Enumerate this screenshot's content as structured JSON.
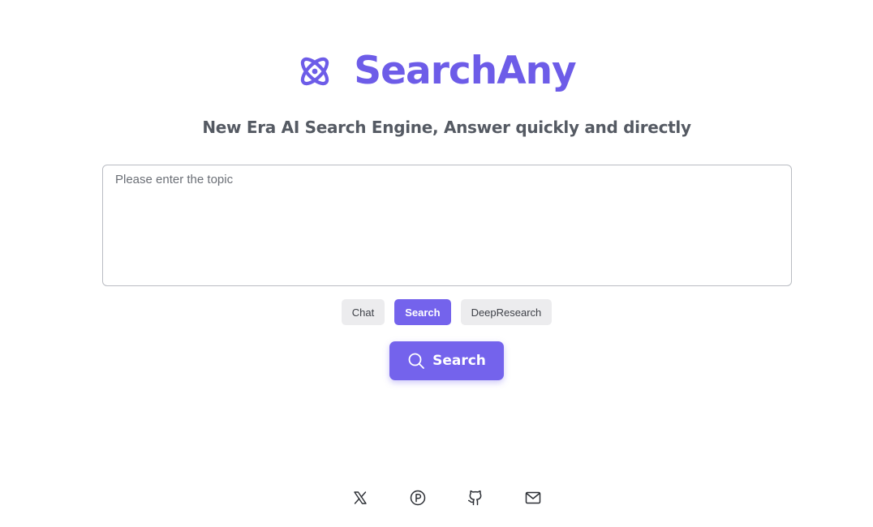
{
  "brand": {
    "name": "SearchAny",
    "logo_icon": "atom-icon",
    "color": "#6d5ce8"
  },
  "tagline": "New Era AI Search Engine, Answer quickly and directly",
  "topic_input": {
    "placeholder": "Please enter the topic",
    "value": ""
  },
  "modes": {
    "selected": "Search",
    "items": [
      {
        "label": "Chat",
        "active": false
      },
      {
        "label": "Search",
        "active": true
      },
      {
        "label": "DeepResearch",
        "active": false
      }
    ]
  },
  "search_button": {
    "label": "Search",
    "icon": "search-icon",
    "color": "#7463ec"
  },
  "footer": {
    "links": [
      {
        "icon": "x-twitter-icon"
      },
      {
        "icon": "product-hunt-icon"
      },
      {
        "icon": "github-icon"
      },
      {
        "icon": "mail-icon"
      }
    ]
  }
}
